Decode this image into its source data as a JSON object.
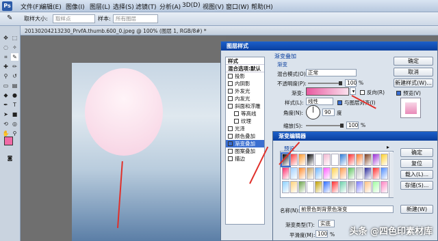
{
  "app": {
    "logo": "Ps",
    "menus": [
      "文件(F)",
      "编辑(E)",
      "图像(I)",
      "图层(L)",
      "选择(S)",
      "滤镜(T)",
      "分析(A)",
      "3D(D)",
      "视图(V)",
      "窗口(W)",
      "帮助(H)"
    ]
  },
  "options": {
    "sample_size_label": "取样大小:",
    "sample_size_value": "取样点",
    "sample_label": "样本:",
    "sample_value": "所有图层"
  },
  "document": {
    "tab_title": "20130204213230_PrvfA.thumb.600_0.jpeg @ 100% (图层 1, RGB/8#) *"
  },
  "layer_style": {
    "title": "图层样式",
    "list": [
      {
        "label": "样式",
        "checkbox": false,
        "checked": false,
        "active": false
      },
      {
        "label": "混合选项:默认",
        "checkbox": false,
        "checked": false,
        "active": false
      },
      {
        "label": "投影",
        "checkbox": true,
        "checked": false,
        "active": false
      },
      {
        "label": "内阴影",
        "checkbox": true,
        "checked": false,
        "active": false
      },
      {
        "label": "外发光",
        "checkbox": true,
        "checked": false,
        "active": false
      },
      {
        "label": "内发光",
        "checkbox": true,
        "checked": false,
        "active": false
      },
      {
        "label": "斜面和浮雕",
        "checkbox": true,
        "checked": false,
        "active": false
      },
      {
        "label": "等高线",
        "checkbox": true,
        "checked": false,
        "active": false
      },
      {
        "label": "纹理",
        "checkbox": true,
        "checked": false,
        "active": false
      },
      {
        "label": "光泽",
        "checkbox": true,
        "checked": false,
        "active": false
      },
      {
        "label": "颜色叠加",
        "checkbox": true,
        "checked": false,
        "active": false
      },
      {
        "label": "渐变叠加",
        "checkbox": true,
        "checked": true,
        "active": true
      },
      {
        "label": "图案叠加",
        "checkbox": true,
        "checked": false,
        "active": false
      },
      {
        "label": "描边",
        "checkbox": true,
        "checked": false,
        "active": false
      }
    ],
    "section_title": "渐变叠加",
    "subsection": "渐变",
    "blend_mode_label": "混合模式(O):",
    "blend_mode_value": "正常",
    "opacity_label": "不透明度(P):",
    "opacity_value": "100",
    "opacity_level": 1.0,
    "gradient_label": "渐变:",
    "reverse_label": "反向(R)",
    "style_label": "样式(L):",
    "style_value": "线性",
    "align_label": "与图层对齐(I)",
    "angle_label": "角度(N):",
    "angle_value": "90",
    "angle_unit": "度",
    "scale_label": "缩放(S):",
    "scale_value": "100",
    "scale_level": 1.0,
    "percent": "%",
    "ok": "确定",
    "cancel": "取消",
    "new_style": "新建样式(W)...",
    "preview": "预览(V)"
  },
  "gradient_editor": {
    "title": "渐变编辑器",
    "presets_label": "预设",
    "ok": "确定",
    "reset": "复位",
    "load": "载入(L)...",
    "save": "存储(S)...",
    "name_label": "名称(N):",
    "name_value": "前景色到背景色渐变",
    "new": "新建(W)",
    "type_label": "渐变类型(T):",
    "type_value": "实底",
    "smooth_label": "平滑度(M):",
    "smooth_value": "100",
    "percent": "%",
    "presets": [
      "#000000",
      "#ff3b3b",
      "#ff9a2a",
      "#000000",
      "#ffffff",
      "#f2b6d0",
      "#ffffff",
      "#2b7ad6",
      "#ff2a2a",
      "#ff7a2a",
      "#7a3a1a",
      "#9a2ad6",
      "#ffd02a",
      "#ff2a6a",
      "#a0d0ff",
      "#ff8a2a",
      "#c4a060",
      "#6ab4ff",
      "#ff5aff",
      "#ffd24a",
      "#ff9a4a",
      "#5ac25a",
      "#c0c0c0",
      "#2a2a9a",
      "#ff2a2a",
      "#4a8aff",
      "#8ad0ff",
      "#ffd27a",
      "#6aa24a",
      "#ffffff",
      "#c0a000",
      "#2a6aff",
      "#ff2a2a",
      "#6ad0aa",
      "#a0a0a0",
      "#7a7aff",
      "#ffc080",
      "#a0ffa0",
      "#ff80c0"
    ]
  },
  "watermark": "头条 @四色印素材库"
}
